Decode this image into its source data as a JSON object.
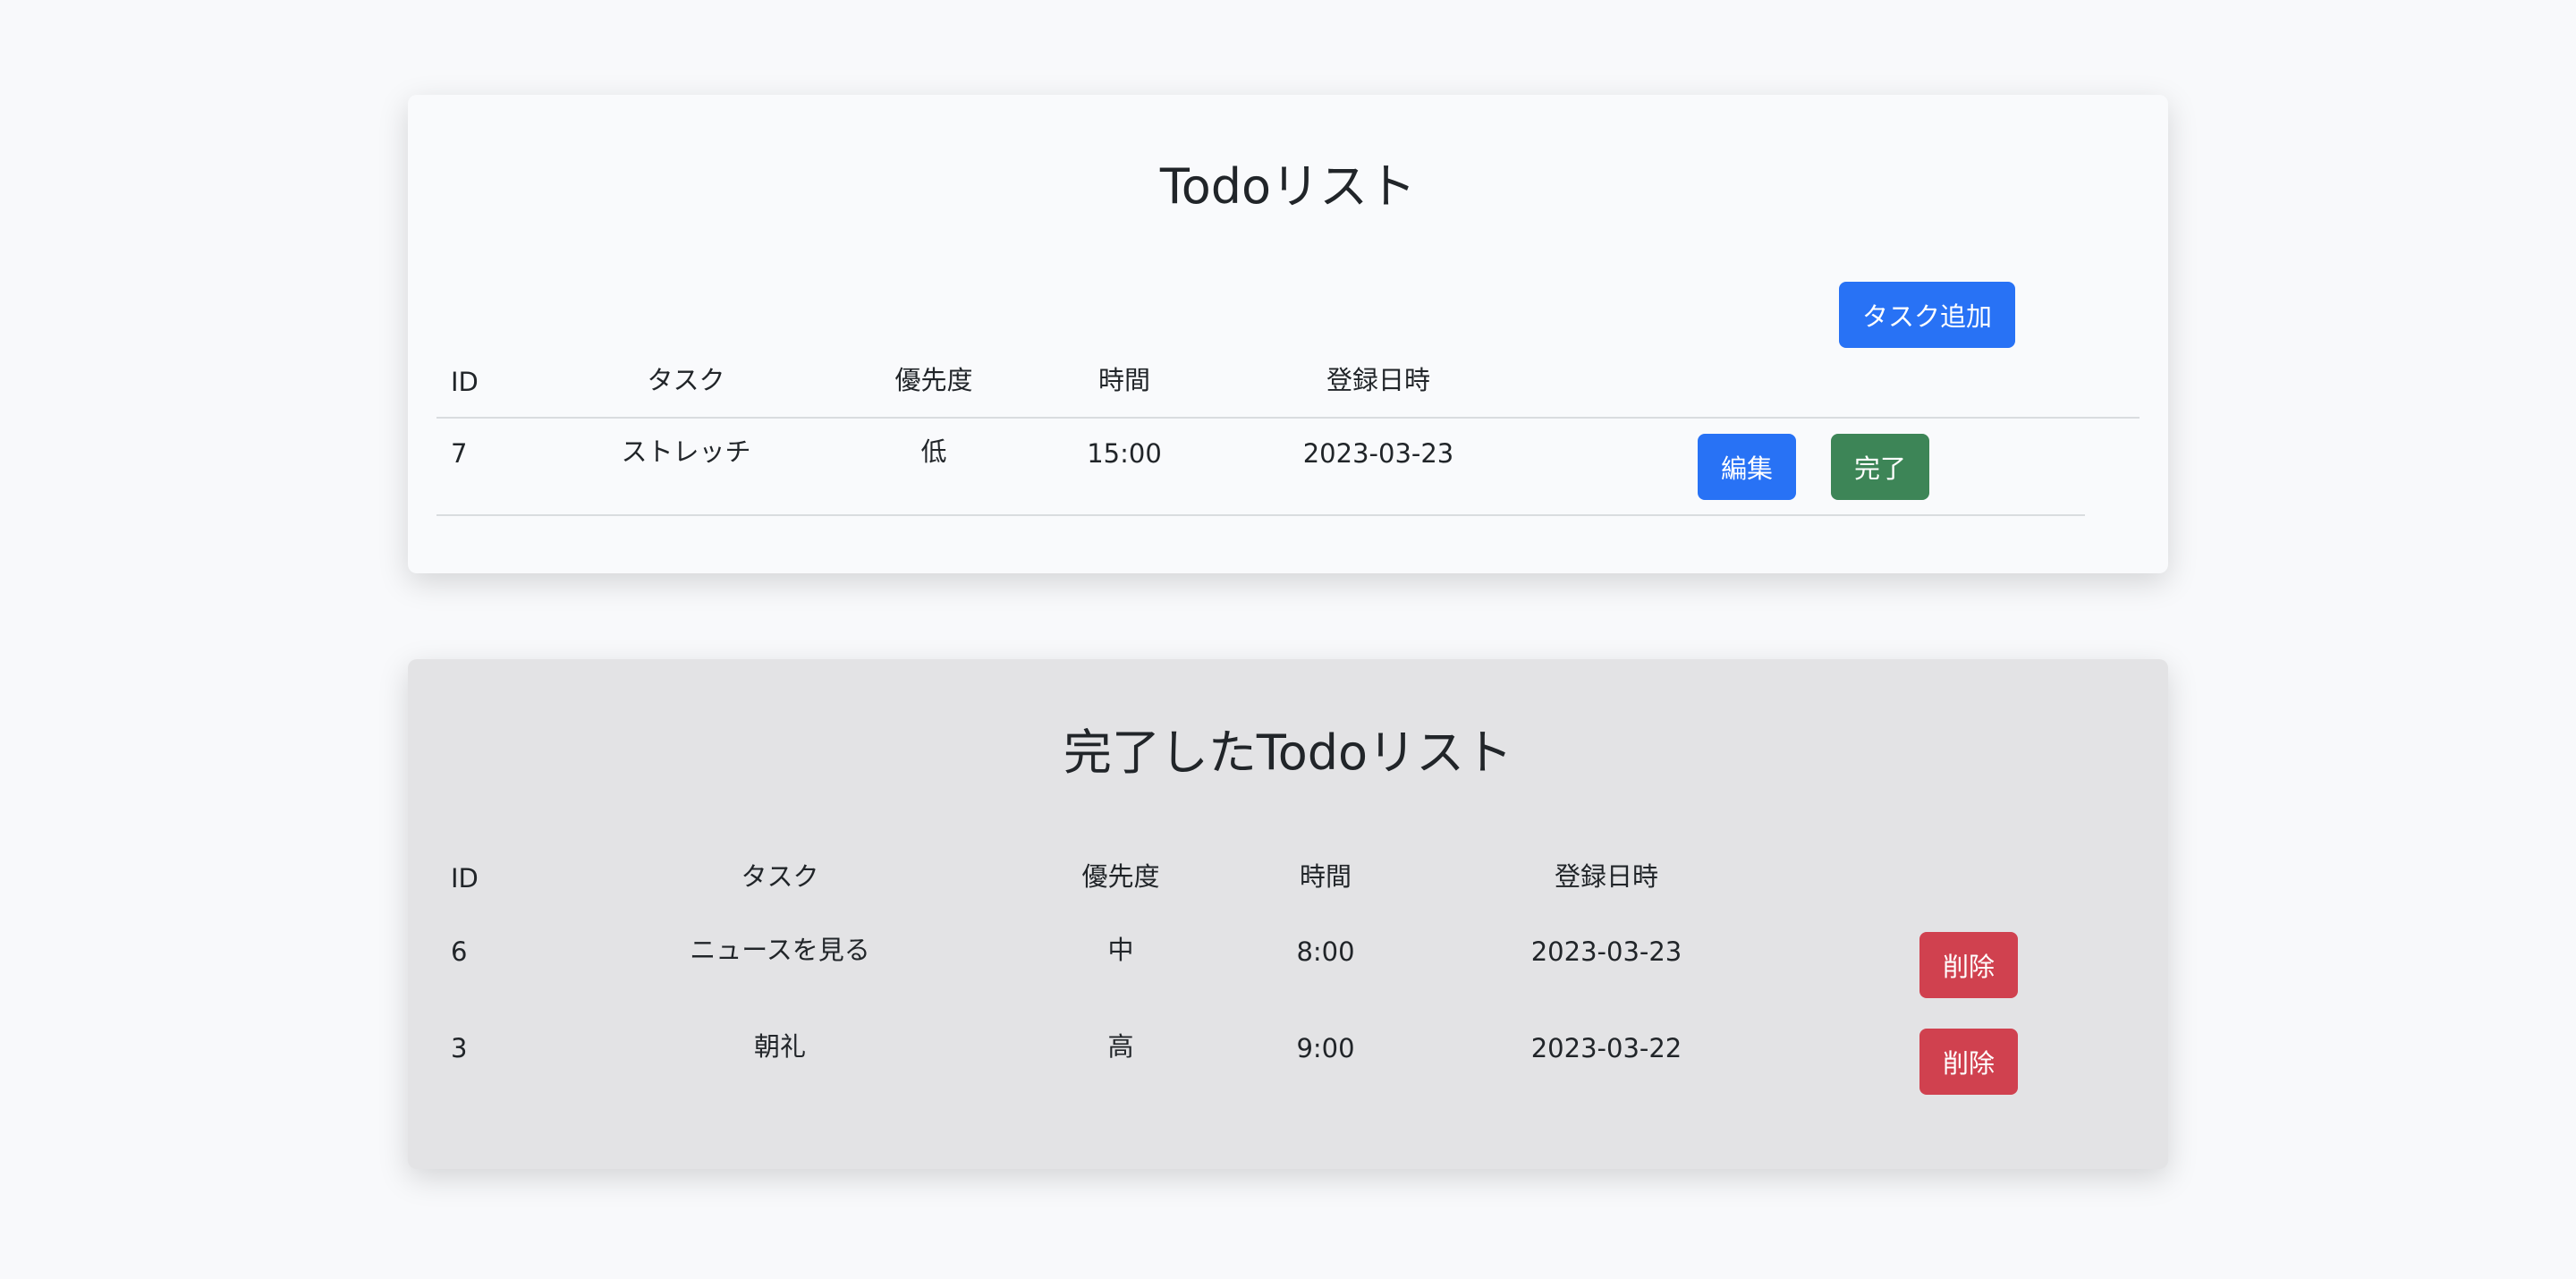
{
  "todo": {
    "title": "Todoリスト",
    "add_button": "タスク追加",
    "headers": [
      "ID",
      "タスク",
      "優先度",
      "時間",
      "登録日時"
    ],
    "rows": [
      {
        "id": "7",
        "task": "ストレッチ",
        "priority": "低",
        "time": "15:00",
        "date": "2023-03-23",
        "edit": "編集",
        "complete": "完了"
      }
    ]
  },
  "done": {
    "title": "完了したTodoリスト",
    "headers": [
      "ID",
      "タスク",
      "優先度",
      "時間",
      "登録日時"
    ],
    "rows": [
      {
        "id": "6",
        "task": "ニュースを見る",
        "priority": "中",
        "time": "8:00",
        "date": "2023-03-23",
        "delete": "削除"
      },
      {
        "id": "3",
        "task": "朝礼",
        "priority": "高",
        "time": "9:00",
        "date": "2023-03-22",
        "delete": "削除"
      }
    ]
  },
  "colors": {
    "primary": "#2872f5",
    "success": "#3d8557",
    "danger": "#d0414f"
  }
}
